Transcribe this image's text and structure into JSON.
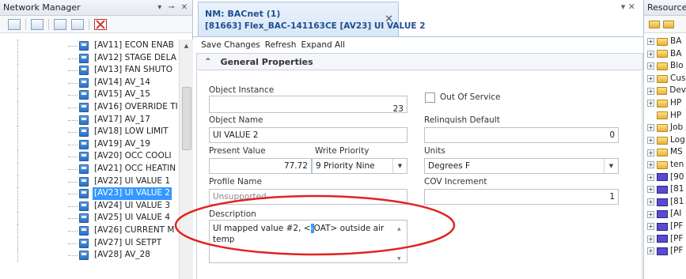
{
  "left_pane": {
    "title": "Network Manager",
    "tree_items": [
      {
        "label": "[AV11] ECON ENAB",
        "selected": false
      },
      {
        "label": "[AV12] STAGE DELA",
        "selected": false
      },
      {
        "label": "[AV13] FAN SHUTO",
        "selected": false
      },
      {
        "label": "[AV14] AV_14",
        "selected": false
      },
      {
        "label": "[AV15] AV_15",
        "selected": false
      },
      {
        "label": "[AV16] OVERRIDE TI",
        "selected": false
      },
      {
        "label": "[AV17] AV_17",
        "selected": false
      },
      {
        "label": "[AV18] LOW LIMIT",
        "selected": false
      },
      {
        "label": "[AV19] AV_19",
        "selected": false
      },
      {
        "label": "[AV20] OCC COOLI",
        "selected": false
      },
      {
        "label": "[AV21] OCC HEATIN",
        "selected": false
      },
      {
        "label": "[AV22] UI VALUE 1",
        "selected": false
      },
      {
        "label": "[AV23] UI VALUE 2",
        "selected": true
      },
      {
        "label": "[AV24] UI VALUE 3",
        "selected": false
      },
      {
        "label": "[AV25] UI VALUE 4",
        "selected": false
      },
      {
        "label": "[AV26] CURRENT M",
        "selected": false
      },
      {
        "label": "[AV27] UI SETPT",
        "selected": false
      },
      {
        "label": "[AV28] AV_28",
        "selected": false
      }
    ]
  },
  "tab": {
    "line1": "NM: BACnet (1)",
    "line2": "[81663] Flex_BAC-141163CE [AV23] UI VALUE 2"
  },
  "commands": {
    "save": "Save Changes",
    "refresh": "Refresh",
    "expand": "Expand All"
  },
  "section": {
    "title": "General Properties"
  },
  "fields": {
    "object_instance_label": "Object Instance",
    "object_instance_value": "23",
    "out_of_service_label": "Out Of Service",
    "object_name_label": "Object Name",
    "object_name_value": "UI VALUE 2",
    "relinquish_default_label": "Relinquish Default",
    "relinquish_default_value": "0",
    "present_value_label": "Present Value",
    "present_value_value": "77.72",
    "write_priority_label": "Write Priority",
    "write_priority_value": "9  Priority Nine",
    "units_label": "Units",
    "units_value": "Degrees F",
    "profile_name_label": "Profile Name",
    "profile_name_value": "Unsupported",
    "cov_increment_label": "COV Increment",
    "cov_increment_value": "1",
    "description_label": "Description",
    "description_before": "UI mapped value #2, <",
    "description_selected": "-",
    "description_after": "OAT> outside air",
    "description_line2": "temp"
  },
  "right_pane": {
    "title": "Resource M",
    "items": [
      {
        "label": "BA",
        "kind": "folder",
        "expandable": true
      },
      {
        "label": "BA",
        "kind": "folder",
        "expandable": true
      },
      {
        "label": "Blo",
        "kind": "folder",
        "expandable": true
      },
      {
        "label": "Cus",
        "kind": "folder",
        "expandable": true
      },
      {
        "label": "Dev",
        "kind": "folder",
        "expandable": true
      },
      {
        "label": "HP",
        "kind": "folder",
        "expandable": true
      },
      {
        "label": "HP",
        "kind": "folder",
        "expandable": false
      },
      {
        "label": "Job",
        "kind": "folder",
        "expandable": true
      },
      {
        "label": "Log",
        "kind": "folder",
        "expandable": true
      },
      {
        "label": "MS",
        "kind": "folder",
        "expandable": true
      },
      {
        "label": "ten",
        "kind": "folder",
        "expandable": true
      },
      {
        "label": "[90",
        "kind": "bac",
        "expandable": true
      },
      {
        "label": "[81",
        "kind": "bac",
        "expandable": true
      },
      {
        "label": "[81",
        "kind": "bac",
        "expandable": true
      },
      {
        "label": "[AI",
        "kind": "bac",
        "expandable": true
      },
      {
        "label": "[PF",
        "kind": "bac",
        "expandable": true
      },
      {
        "label": "[PF",
        "kind": "bac",
        "expandable": true
      },
      {
        "label": "[PF",
        "kind": "bac",
        "expandable": true
      }
    ]
  },
  "colors": {
    "selection": "#3399ff",
    "annotation_circle": "#e0231f",
    "tab_text": "#1f4f8f"
  }
}
